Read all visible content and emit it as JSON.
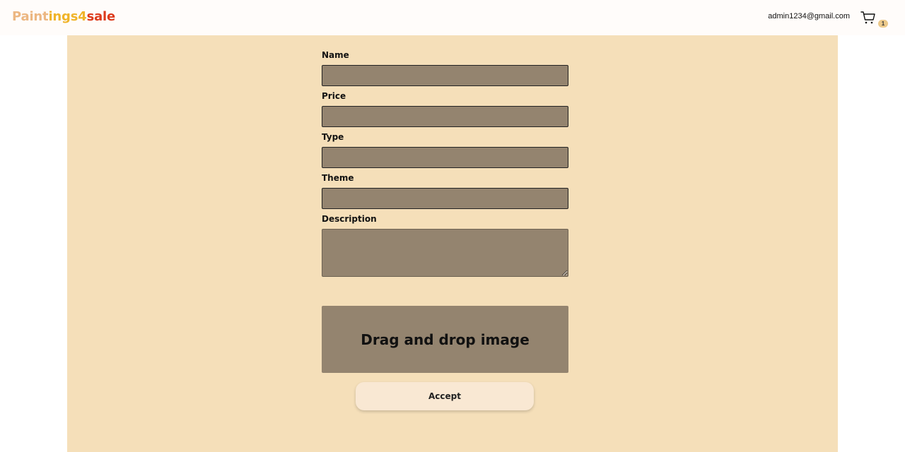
{
  "header": {
    "logo_part1": "Paint",
    "logo_part2": "ings4",
    "logo_part3": "sale",
    "user_email": "admin1234@gmail.com",
    "cart_icon": "cart-icon",
    "cart_count": "1"
  },
  "form": {
    "name_label": "Name",
    "name_value": "",
    "price_label": "Price",
    "price_value": "",
    "type_label": "Type",
    "type_value": "",
    "theme_label": "Theme",
    "theme_value": "",
    "description_label": "Description",
    "description_value": "",
    "dropzone_text": "Drag and drop image",
    "accept_label": "Accept"
  },
  "colors": {
    "header_bg": "#fffcfa",
    "panel_bg": "#f5dfb9",
    "input_bg": "#94846f",
    "button_bg": "#f9e8d3",
    "logo_color_1": "#ecb782",
    "logo_color_2": "#f0b429",
    "logo_color_3": "#dd3b1c"
  }
}
